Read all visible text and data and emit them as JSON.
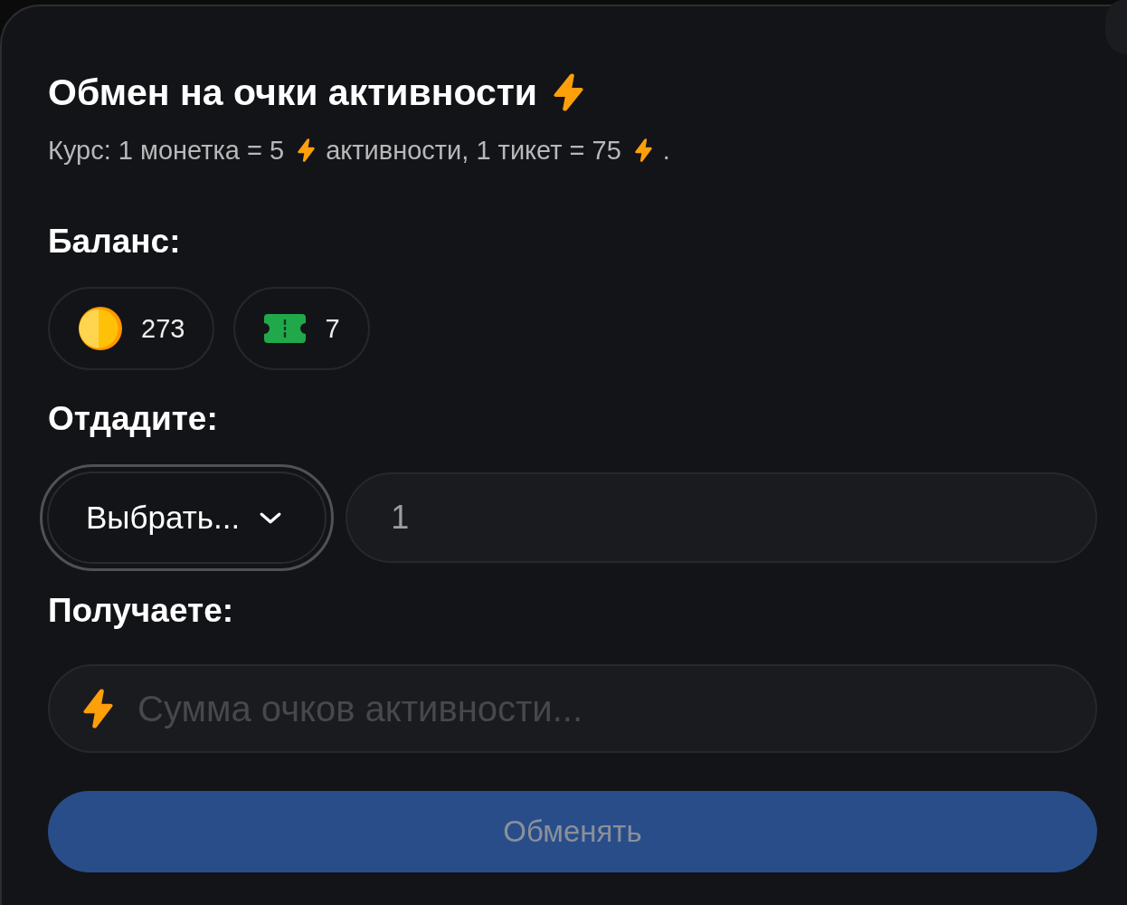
{
  "title": {
    "text": "Обмен на очки активности"
  },
  "rate": [
    {
      "kind": "text",
      "text": "Курс: 1 монетка = 5"
    },
    {
      "kind": "icon"
    },
    {
      "kind": "text",
      "text": "активности, 1 тикет = 75"
    },
    {
      "kind": "icon"
    },
    {
      "kind": "text",
      "text": "."
    }
  ],
  "balance": {
    "label": "Баланс:",
    "items": [
      {
        "kind": "coin",
        "amount": "273"
      },
      {
        "kind": "ticket",
        "amount": "7"
      }
    ]
  },
  "give": {
    "label": "Отдадите:",
    "select": {
      "value": "Выбрать...",
      "focused": true
    },
    "amount": {
      "value": "1"
    }
  },
  "receive": {
    "label": "Получаете:",
    "field": {
      "placeholder": "Сумма очков активности..."
    }
  },
  "submit": {
    "label": "Обменять",
    "disabled": true
  }
}
